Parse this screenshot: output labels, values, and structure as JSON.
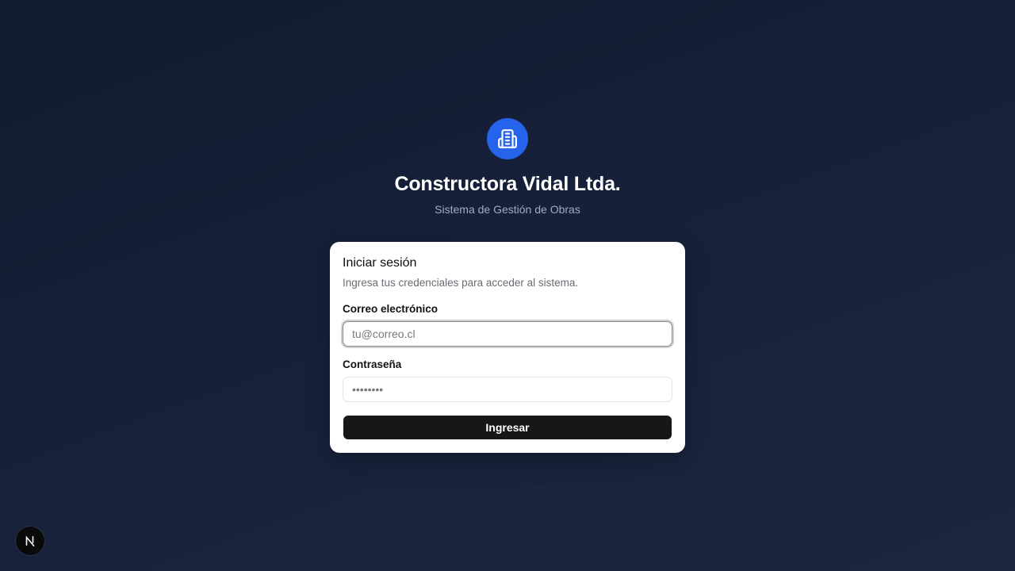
{
  "brand": {
    "title": "Constructora Vidal Ltda.",
    "subtitle": "Sistema de Gestión de Obras",
    "logo_icon": "building-icon",
    "accent_color": "#2563eb"
  },
  "login": {
    "title": "Iniciar sesión",
    "description": "Ingresa tus credenciales para acceder al sistema.",
    "email_label": "Correo electrónico",
    "email_placeholder": "tu@correo.cl",
    "password_label": "Contraseña",
    "password_placeholder": "••••••••",
    "submit_label": "Ingresar",
    "button_color": "#171717"
  },
  "dev_badge": {
    "icon": "nextjs-icon"
  }
}
